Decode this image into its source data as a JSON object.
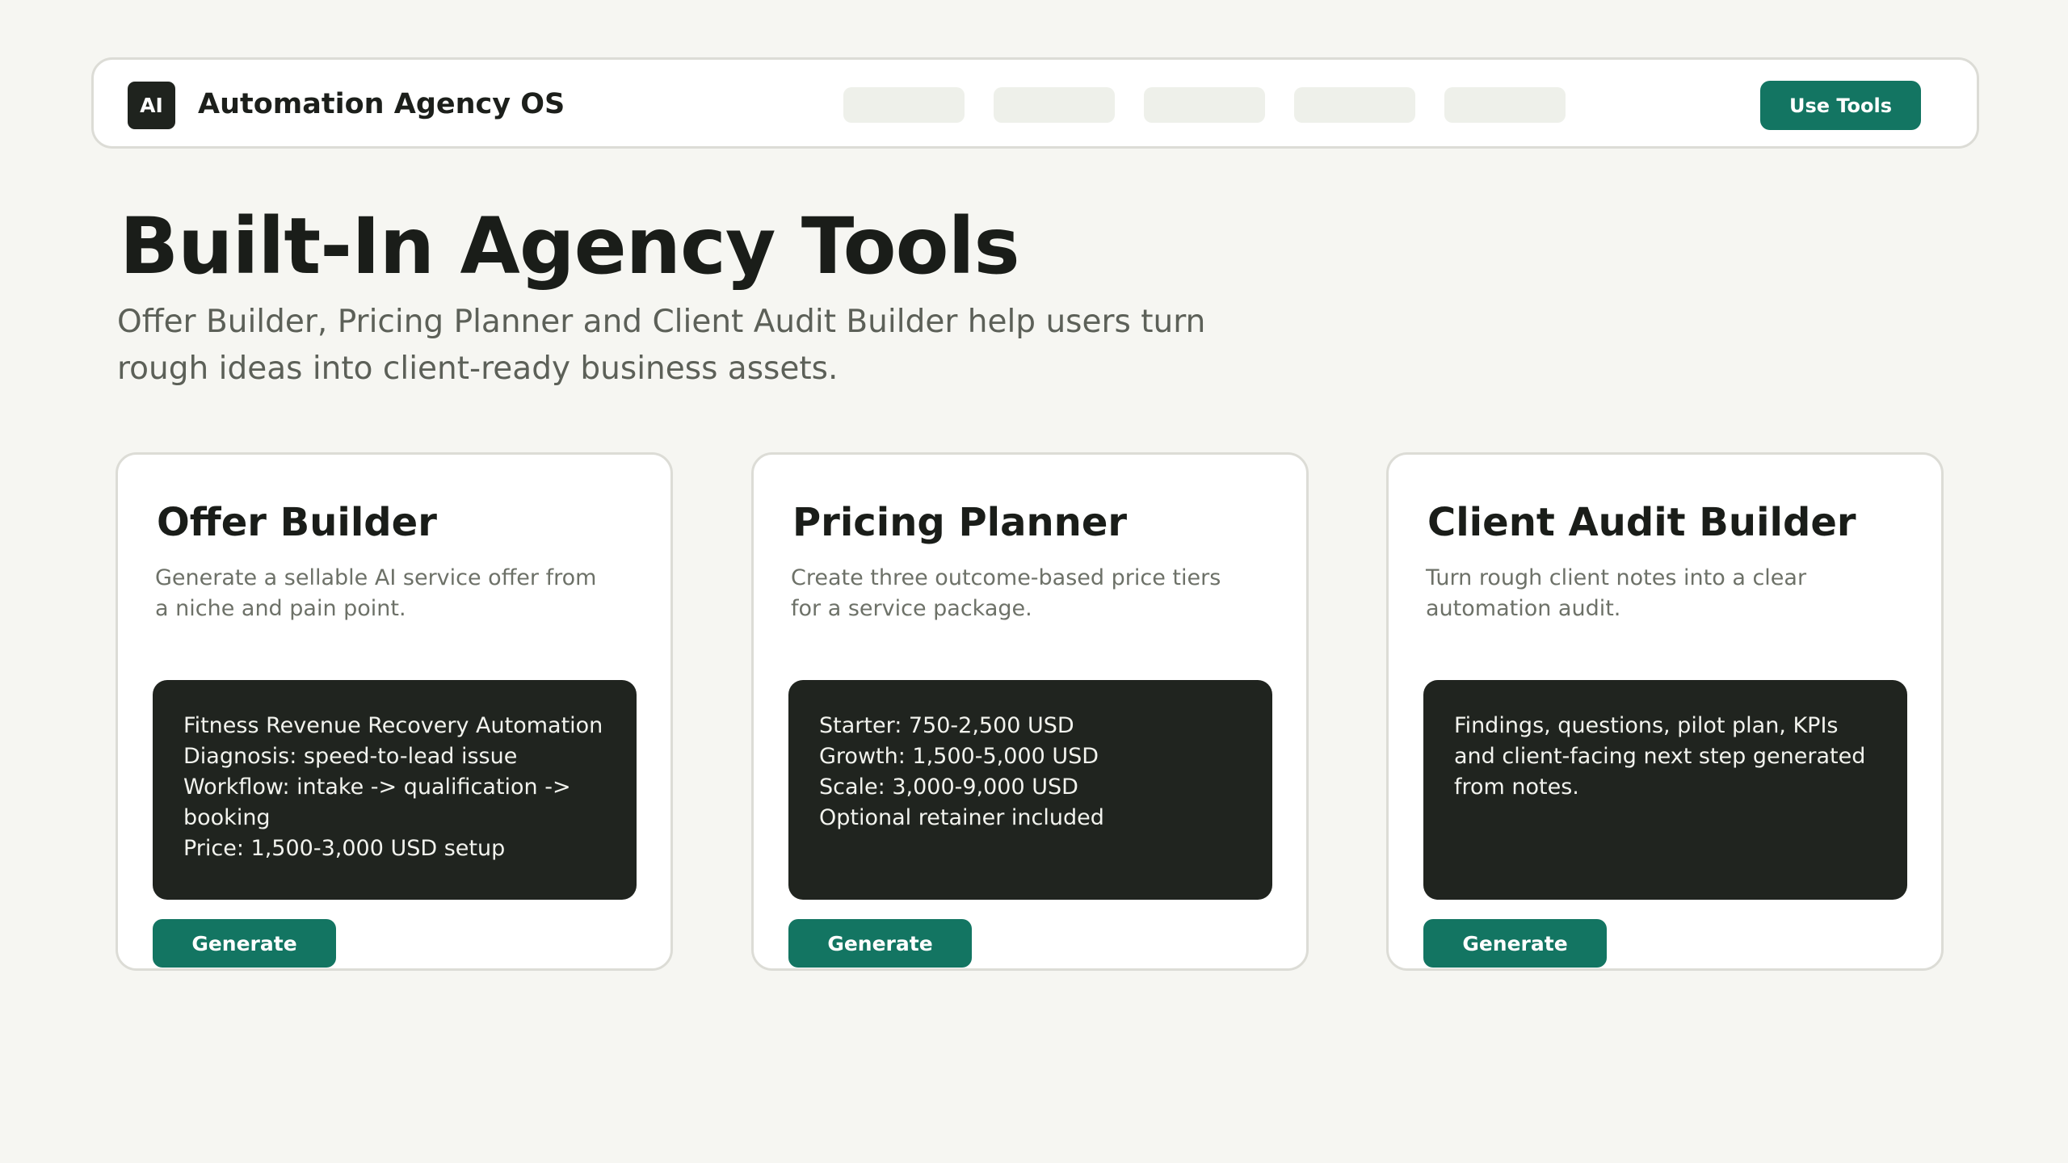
{
  "header": {
    "logo_text": "AI",
    "app_title": "Automation Agency OS",
    "nav_placeholders": 5,
    "cta_label": "Use Tools"
  },
  "hero": {
    "title": "Built-In Agency Tools",
    "subtitle": "Offer Builder, Pricing Planner and Client Audit Builder help users turn rough ideas into client-ready business assets."
  },
  "cards": [
    {
      "title": "Offer Builder",
      "description": "Generate a sellable AI service offer from a niche and pain point.",
      "output": [
        "Fitness Revenue Recovery Automation",
        "Diagnosis: speed-to-lead issue",
        "Workflow: intake -> qualification -> booking",
        "Price: 1,500-3,000 USD setup"
      ],
      "button_label": "Generate"
    },
    {
      "title": "Pricing Planner",
      "description": "Create three outcome-based price tiers for a service package.",
      "output": [
        "Starter: 750-2,500 USD",
        "Growth: 1,500-5,000 USD",
        "Scale: 3,000-9,000 USD",
        "Optional retainer included"
      ],
      "button_label": "Generate"
    },
    {
      "title": "Client Audit Builder",
      "description": "Turn rough client notes into a clear automation audit.",
      "output": [
        "Findings, questions, pilot plan, KPIs and client-facing next step generated from notes."
      ],
      "button_label": "Generate"
    }
  ],
  "colors": {
    "background": "#f6f6f2",
    "accent": "#137562",
    "dark_panel": "#20241f",
    "nav_pill": "#eef0ea"
  }
}
